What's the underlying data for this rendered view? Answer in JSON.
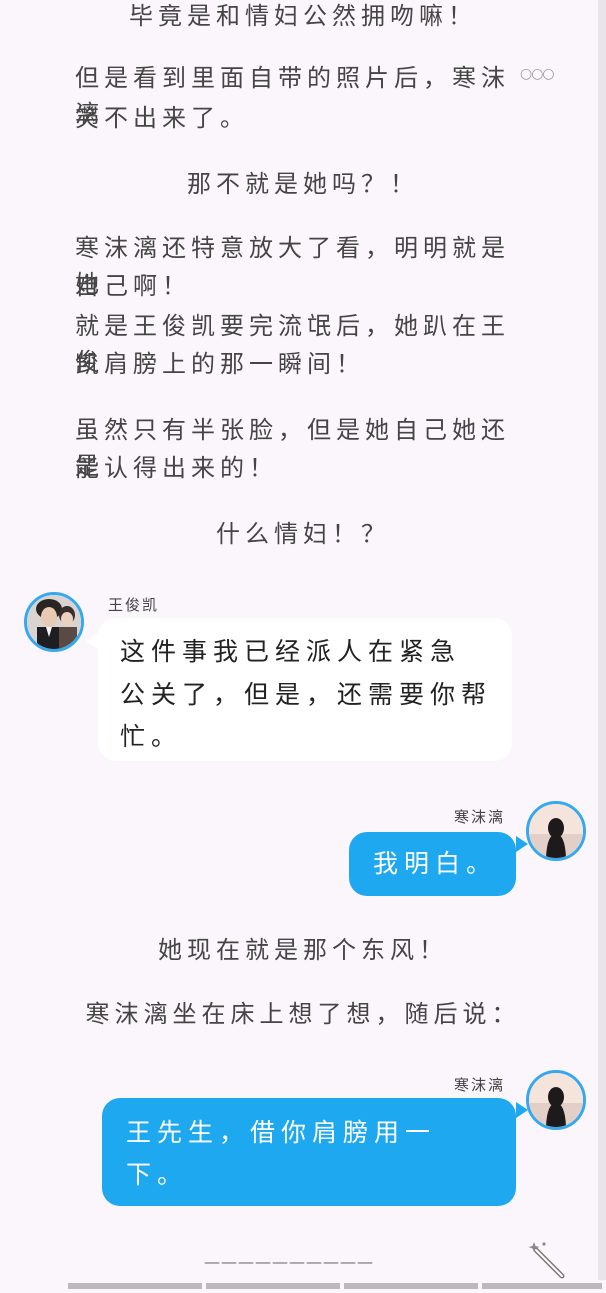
{
  "story": {
    "p_top": "毕竟是和情妇公然拥吻嘛！",
    "p1_line1": "但是看到里面自带的照片后，寒沫漓",
    "p1_line2": "笑不出来了。",
    "p2": "那不就是她吗？！",
    "p3_line1": "寒沫漓还特意放大了看，明明就是她",
    "p3_line2": "自己啊！",
    "p3_line3": "就是王俊凯要完流氓后，她趴在王俊",
    "p3_line4": "凯肩膀上的那一瞬间！",
    "p4_line1": "虽然只有半张脸，但是她自己她还是",
    "p4_line2": "能认得出来的！",
    "p5": "什么情妇！？",
    "p6": "她现在就是那个东风！",
    "p7": "寒沫漓坐在床上想了想，随后说："
  },
  "messages": [
    {
      "speaker": "王俊凯",
      "side": "left",
      "line1": "这件事我已经派人在紧急",
      "line2": "公关了，但是，还需要你帮",
      "line3": "忙。"
    },
    {
      "speaker": "寒沫漓",
      "side": "right",
      "line1": "我明白。"
    },
    {
      "speaker": "寒沫漓",
      "side": "right",
      "line1": "王先生，借你肩膀用一",
      "line2": "下。"
    }
  ],
  "more_indicator": "○○○",
  "end_marker": "——————————",
  "icons": {
    "avatar_left": "male-avatar-icon",
    "avatar_right": "female-avatar-icon",
    "magic_wand": "magic-wand-icon"
  },
  "colors": {
    "background": "#fbf6fb",
    "bubble_blue": "#1da8ef",
    "avatar_border": "#35a8f0"
  }
}
